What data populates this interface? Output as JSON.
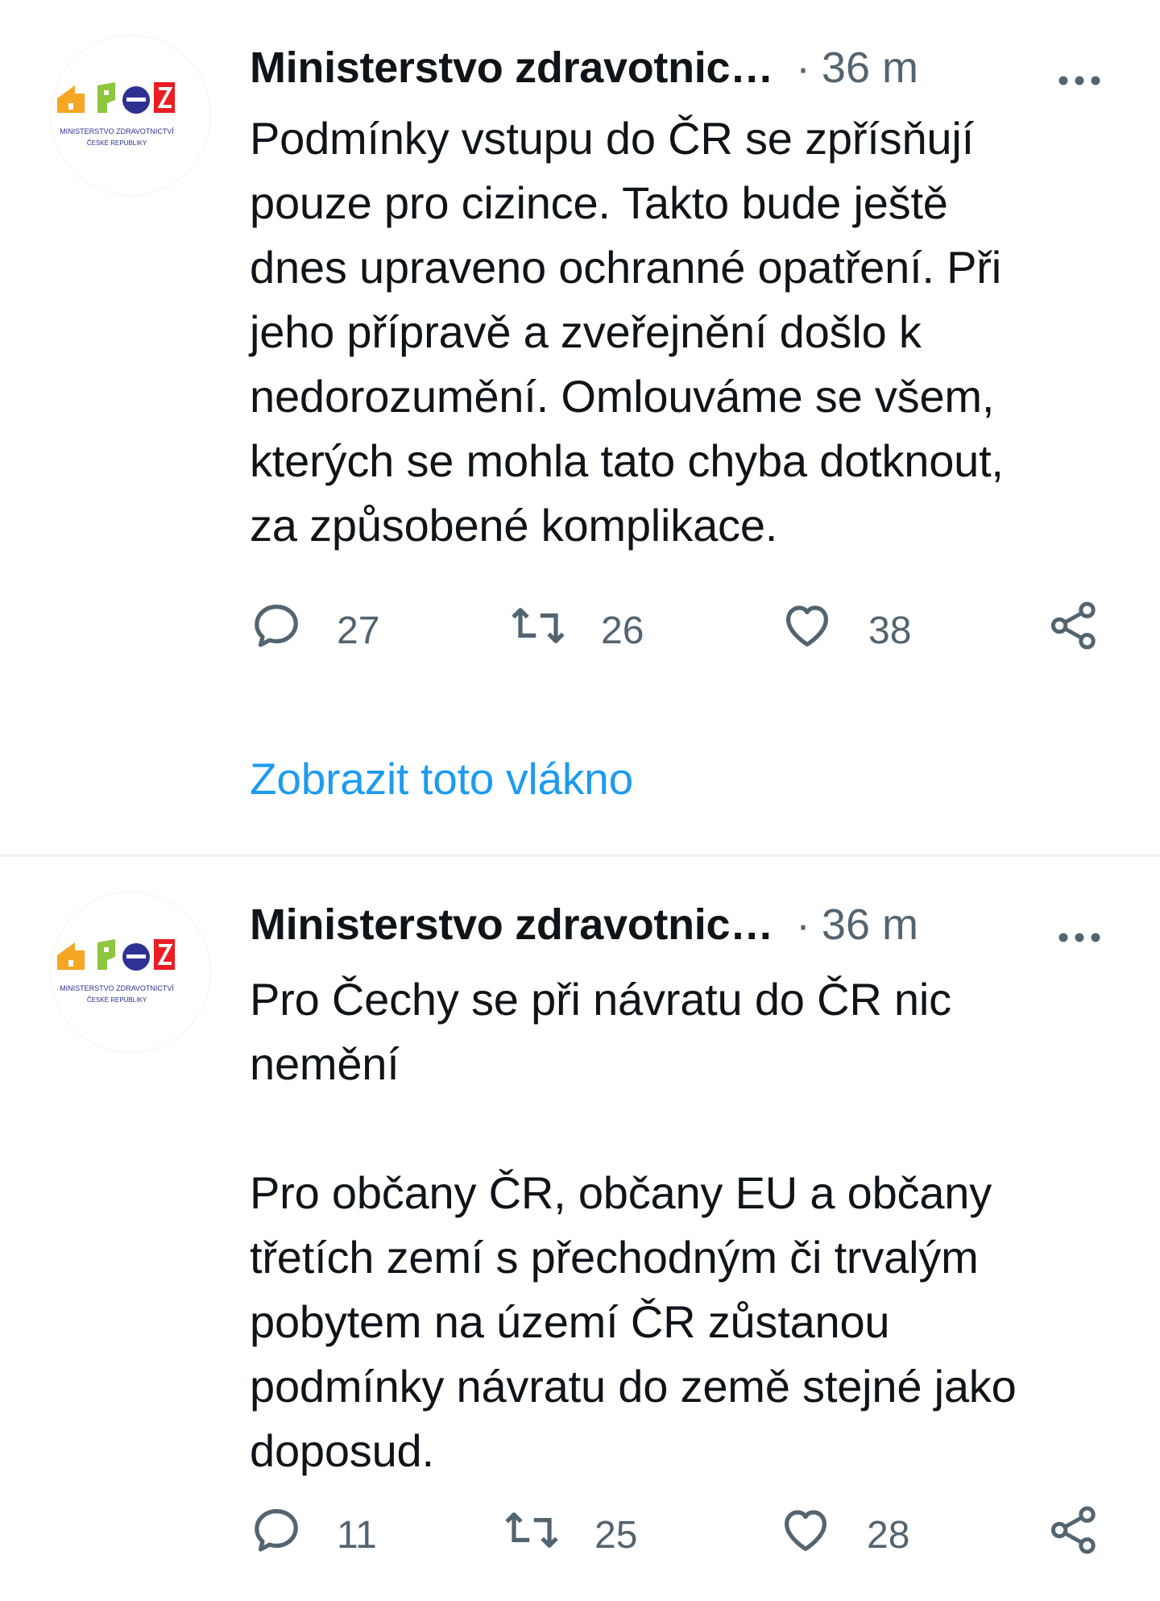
{
  "tweets": [
    {
      "author": "Ministerstvo zdravotnic…",
      "separator": "·",
      "time": "36 m",
      "text": "Podmínky vstupu do ČR se zpřísňují\npouze pro cizince. Takto bude ještě\ndnes upraveno ochranné opatření. Při\njeho přípravě a zveřejnění došlo k\nnedorozumění. Omlouváme se všem,\nkterých se mohla tato chyba dotknout,\nza způsobené komplikace.",
      "replies": "27",
      "retweets": "26",
      "likes": "38",
      "thread_link": "Zobrazit toto vlákno"
    },
    {
      "author": "Ministerstvo zdravotnic…",
      "separator": "·",
      "time": "36 m",
      "text": "Pro Čechy se při návratu do ČR nic\nnemění\n\nPro občany ČR, občany EU a občany\ntřetích zemí s přechodným či trvalým\npobytem na území ČR zůstanou\npodmínky návratu do země stejné jako\ndoposud.",
      "replies": "11",
      "retweets": "25",
      "likes": "28"
    }
  ],
  "logo": {
    "line1": "MINISTERSTVO ZDRAVOTNICTVÍ",
    "line2": "ČESKÉ REPUBLIKY",
    "colors": [
      "#f5a623",
      "#8dc63f",
      "#2e3192",
      "#ed1c24"
    ]
  },
  "icons": {
    "more": "more-horizontal-icon",
    "reply": "reply-icon",
    "retweet": "retweet-icon",
    "like": "heart-icon",
    "share": "share-icon"
  },
  "colors": {
    "text": "#0f1419",
    "secondary": "#536471",
    "link": "#1d9bf0",
    "divider": "#eff3f4"
  }
}
